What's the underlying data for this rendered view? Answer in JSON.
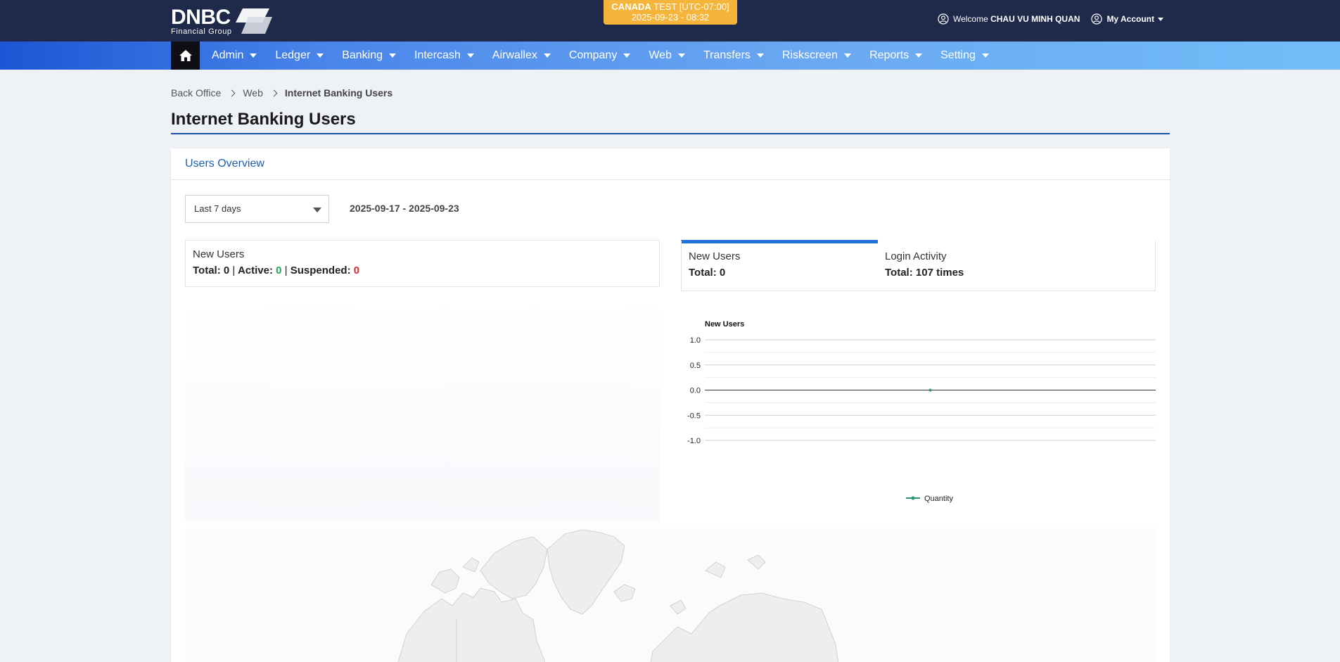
{
  "header": {
    "logo_text": "DNBC",
    "logo_subtext": "Financial Group",
    "env_label": "CANADA",
    "env_suffix": "TEST [UTC-07:00]",
    "env_datetime": "2025-09-23 - 08:32",
    "welcome_prefix": "Welcome",
    "user_name": "CHAU VU MINH QUAN",
    "account_label": "My Account"
  },
  "nav": {
    "home_icon": "home-icon",
    "items": [
      {
        "label": "Admin"
      },
      {
        "label": "Ledger"
      },
      {
        "label": "Banking"
      },
      {
        "label": "Intercash"
      },
      {
        "label": "Airwallex"
      },
      {
        "label": "Company"
      },
      {
        "label": "Web"
      },
      {
        "label": "Transfers"
      },
      {
        "label": "Riskscreen"
      },
      {
        "label": "Reports"
      },
      {
        "label": "Setting"
      }
    ]
  },
  "breadcrumb": {
    "items": [
      "Back Office",
      "Web"
    ],
    "current": "Internet Banking Users"
  },
  "page": {
    "title": "Internet Banking Users"
  },
  "overview": {
    "card_title": "Users Overview",
    "period_select": "Last 7 days",
    "date_range": "2025-09-17 - 2025-09-23",
    "left_stat": {
      "label": "New Users",
      "total_label": "Total:",
      "total_value": "0",
      "active_label": "Active:",
      "active_value": "0",
      "suspended_label": "Suspended:",
      "suspended_value": "0"
    },
    "tabs": [
      {
        "label": "New Users",
        "value": "Total: 0"
      },
      {
        "label": "Login Activity",
        "value": "Total: 107 times"
      }
    ]
  },
  "colors": {
    "header_bg": "#1f2a4b",
    "accent": "#2173d9",
    "env_badge": "#f5b53a",
    "active_green": "#1ea65a",
    "suspended_red": "#e0262e",
    "series_color": "#2a9a6b"
  },
  "chart_data": {
    "type": "line",
    "title": "New Users",
    "ylim": [
      -1.0,
      1.0
    ],
    "yticks": [
      "1.0",
      "0.5",
      "0.0",
      "-0.5",
      "-1.0"
    ],
    "series": [
      {
        "name": "Quantity",
        "values": [
          0
        ]
      }
    ],
    "legend_position": "bottom",
    "grid": true
  }
}
